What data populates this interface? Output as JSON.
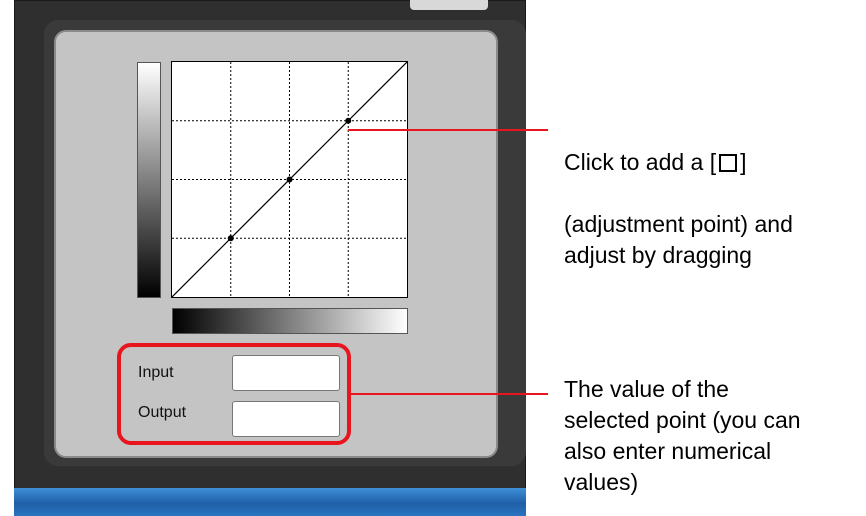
{
  "tone_curve": {
    "input_label": "Input",
    "output_label": "Output",
    "input_value": "",
    "output_value": ""
  },
  "annotations": {
    "adjust_prefix": "Click to add a [",
    "adjust_suffix": "]",
    "adjust_rest": "(adjustment point) and\nadjust by dragging",
    "value_text": "The value of the\nselected point (you can\nalso enter numerical\nvalues)"
  },
  "colors": {
    "highlight": "#e8141e",
    "panel": "#c4c4c4",
    "frame": "#2f2f2f"
  }
}
